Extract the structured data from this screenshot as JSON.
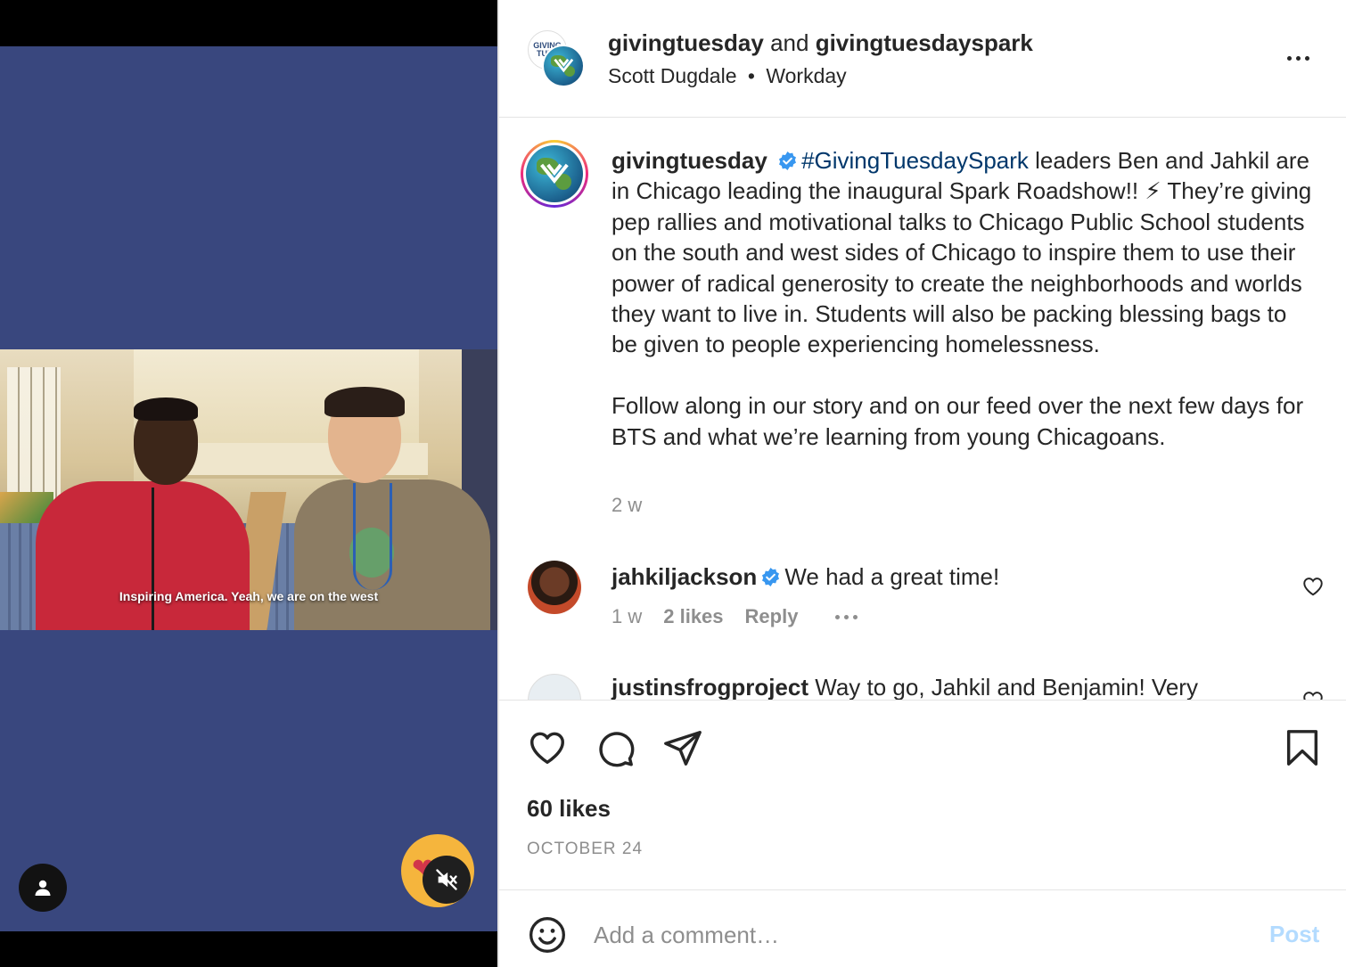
{
  "video": {
    "caption": "Inspiring America. Yeah, we are on the west"
  },
  "header": {
    "author1": "givingtuesday",
    "joiner": "and",
    "author2": "givingtuesdayspark",
    "avatar_text": "GIVING TUES",
    "music": "Scott Dugdale",
    "separator": "•",
    "audio_title": "Workday"
  },
  "post_caption": {
    "username": "givingtuesday",
    "hashtag": "#GivingTuesdaySpark",
    "paragraph1": " leaders Ben and Jahkil are in Chicago leading the inaugural Spark Roadshow!! ⚡ They’re giving pep rallies and motivational talks to Chicago Public School students on the south and west sides of Chicago to inspire them to use their power of radical generosity to create the neighborhoods and worlds they want to live in. Students will also be packing blessing bags to be given to people experiencing homelessness.",
    "paragraph2": "Follow along in our story and on our feed over the next few days for BTS and what we’re learning from young Chicagoans.",
    "time": "2 w"
  },
  "comments": [
    {
      "username": "jahkiljackson",
      "text": "We had a great time!",
      "time": "1 w",
      "likes": "2 likes",
      "reply": "Reply"
    },
    {
      "username": "justinsfrogproject",
      "text": "Way to go, Jahkil and Benjamin! Very"
    }
  ],
  "actions": {
    "likes": "60 likes",
    "date": "OCTOBER 24"
  },
  "add_comment": {
    "placeholder": "Add a comment…",
    "post_label": "Post"
  },
  "colors": {
    "media_bg": "#39477e",
    "link": "#00376b",
    "verified": "#3897f0",
    "post_disabled": "#b3dbff",
    "muted_text": "#8e8e8e"
  }
}
